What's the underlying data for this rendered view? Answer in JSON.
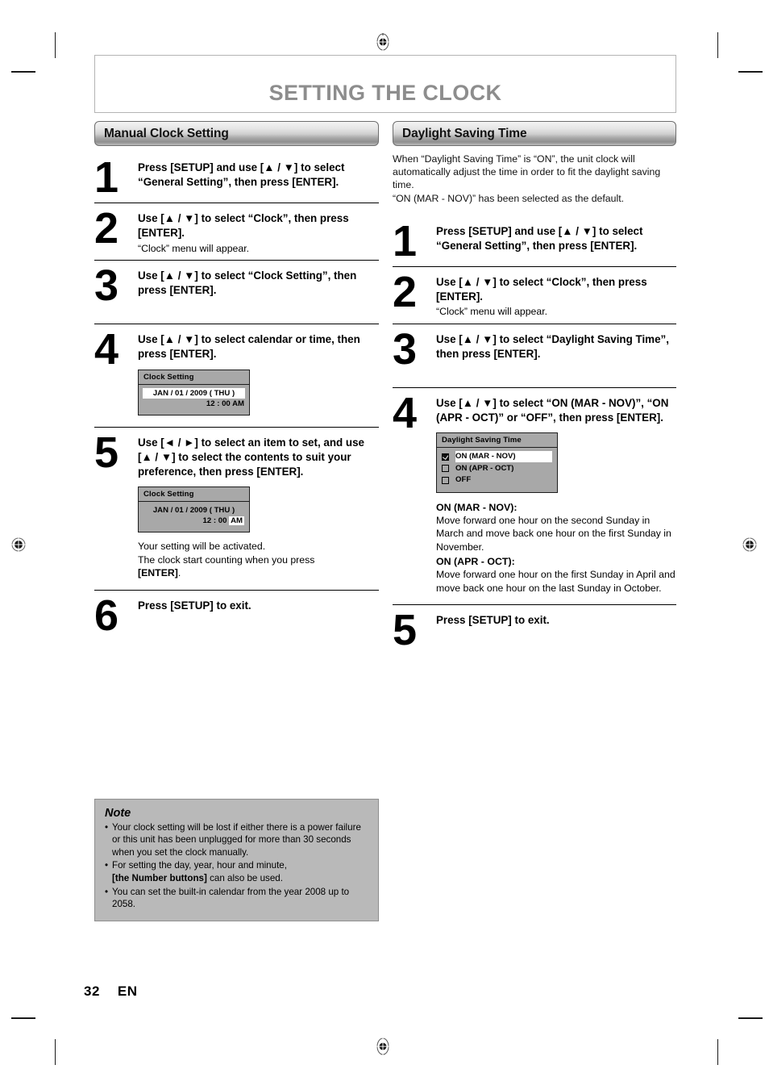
{
  "page": {
    "title": "SETTING THE CLOCK",
    "number": "32",
    "language": "EN"
  },
  "left_column": {
    "section_title": "Manual Clock Setting",
    "steps": [
      {
        "number": "1",
        "title": "Press [SETUP] and use [▲ / ▼] to select “General Setting”, then press [ENTER]."
      },
      {
        "number": "2",
        "title": "Use [▲ / ▼] to select “Clock”, then press [ENTER].",
        "sub": "“Clock” menu will appear."
      },
      {
        "number": "3",
        "title": "Use [▲ / ▼] to select “Clock Setting”, then press [ENTER]."
      },
      {
        "number": "4",
        "title": "Use [▲ / ▼] to select calendar or time, then press [ENTER]."
      },
      {
        "number": "5",
        "title": "Use [◄ / ►] to select an item to set, and use [▲ / ▼] to select the contents to suit your preference, then press [ENTER].",
        "extra_line1": "Your setting will be activated.",
        "extra_line2": "The clock start counting when you press",
        "extra_bold": "[ENTER]",
        "extra_period": "."
      },
      {
        "number": "6",
        "title": "Press [SETUP] to exit."
      }
    ],
    "osd_step4": {
      "title": "Clock Setting",
      "date": "JAN / 01 / 2009 ( THU )",
      "time": "12 : 00 AM"
    },
    "osd_step5": {
      "title": "Clock Setting",
      "date": "JAN / 01 / 2009 ( THU )",
      "time_prefix": "12 : 00 ",
      "time_highlight": "AM"
    }
  },
  "right_column": {
    "section_title": "Daylight Saving Time",
    "intro": "When “Daylight Saving Time” is “ON”, the unit clock will automatically adjust the time in order to fit the daylight saving time.\n“ON (MAR - NOV)” has been selected as the default.",
    "steps": [
      {
        "number": "1",
        "title": "Press [SETUP] and use [▲ / ▼] to select “General Setting”, then press [ENTER]."
      },
      {
        "number": "2",
        "title": "Use [▲ / ▼] to select “Clock”, then press [ENTER].",
        "sub": "“Clock” menu will appear."
      },
      {
        "number": "3",
        "title": "Use [▲ / ▼] to select “Daylight Saving Time”, then press [ENTER]."
      },
      {
        "number": "4",
        "title": "Use [▲ / ▼] to select “ON (MAR - NOV)”, “ON (APR - OCT)” or “OFF”, then press [ENTER]."
      },
      {
        "number": "5",
        "title": "Press [SETUP] to exit."
      }
    ],
    "osd_dst": {
      "title": "Daylight Saving Time",
      "options": [
        {
          "label": "ON (MAR - NOV)",
          "checked": true,
          "selected": true
        },
        {
          "label": "ON (APR - OCT)",
          "checked": false,
          "selected": false
        },
        {
          "label": "OFF",
          "checked": false,
          "selected": false
        }
      ]
    },
    "explanations": [
      {
        "heading": "ON (MAR - NOV):",
        "body": "Move forward one hour on the second Sunday in March and move back one hour on the first Sunday in November."
      },
      {
        "heading": "ON (APR - OCT):",
        "body": "Move forward one hour on the first Sunday in April and move back one hour on the last Sunday in October."
      }
    ]
  },
  "note": {
    "title": "Note",
    "bullet": "•",
    "items": [
      "Your clock setting will be lost if either there is a power failure or this unit has been unplugged for more than 30 seconds when you set the clock manually.",
      "For setting the day, year, hour and minute, [the Number buttons] can also be used.",
      "You can set the built-in calendar from the year 2008 up to 2058."
    ],
    "item2_part1": "For setting the day, year, hour and minute,",
    "item2_bold": "[the Number buttons]",
    "item2_part2": " can also be used."
  },
  "colors": {
    "title_gray": "#8d8d8d",
    "osd_gray": "#a8a8a8",
    "note_gray": "#b9b9b9"
  }
}
